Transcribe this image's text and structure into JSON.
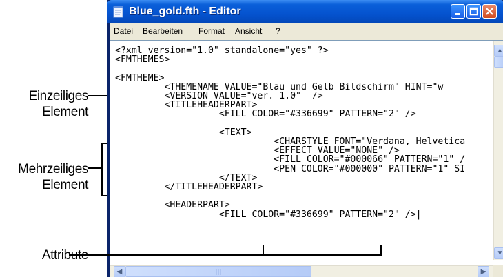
{
  "window": {
    "title": "Blue_gold.fth - Editor"
  },
  "menu": {
    "items": [
      "Datei",
      "Bearbeiten",
      "Format",
      "Ansicht",
      "?"
    ]
  },
  "editor": {
    "lines": [
      "<?xml version=\"1.0\" standalone=\"yes\" ?>",
      "<FMTHEMES>",
      "",
      "<FMTHEME>",
      "         <THEMENAME VALUE=\"Blau und Gelb Bildschirm\" HINT=\"w",
      "         <VERSION VALUE=\"ver. 1.0\"  />",
      "         <TITLEHEADERPART>",
      "                   <FILL COLOR=\"#336699\" PATTERN=\"2\" />",
      "",
      "                   <TEXT>",
      "                             <CHARSTYLE FONT=\"Verdana, Helvetica",
      "                             <EFFECT VALUE=\"NONE\" />",
      "                             <FILL COLOR=\"#000066\" PATTERN=\"1\" /",
      "                             <PEN COLOR=\"#000000\" PATTERN=\"1\" SI",
      "                   </TEXT>",
      "         </TITLEHEADERPART>",
      "",
      "         <HEADERPART>",
      "                   <FILL COLOR=\"#336699\" PATTERN=\"2\" />|"
    ]
  },
  "annotations": {
    "single_line": "Einzeiliges\nElement",
    "multi_line": "Mehrzeiliges\nElement",
    "attribute": "Attribute"
  },
  "colors": {
    "titlebar": "#0553cf",
    "menubar": "#ece9d8",
    "scrollbar": "#f1efe2"
  }
}
